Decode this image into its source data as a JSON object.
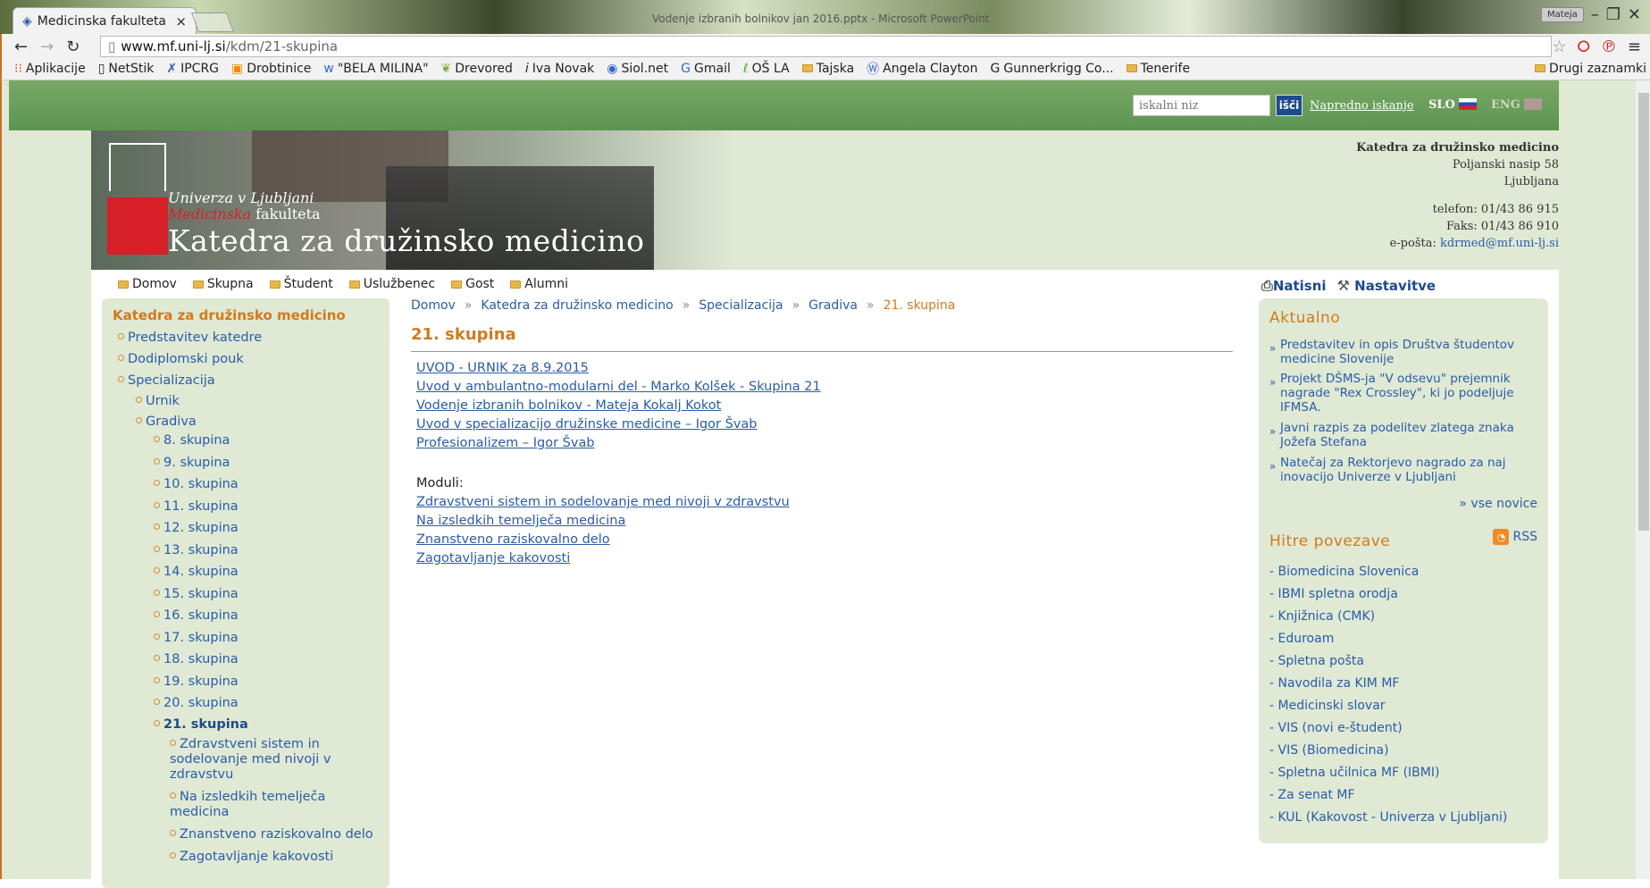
{
  "browser": {
    "tab_title": "Medicinska fakulteta",
    "tab_close": "×",
    "window_title_bg": "Vodenje izbranih bolnikov jan 2016.pptx - Microsoft PowerPoint",
    "user_badge": "Mateja",
    "url_host": "www.mf.uni-lj.si",
    "url_path": "/kdm/21-skupina",
    "bookmarks": [
      "Aplikacije",
      "NetStik",
      "IPCRG",
      "Drobtinice",
      "\"BELA MILINA\"",
      "Drevored",
      "Iva Novak",
      "Siol.net",
      "Gmail",
      "OŠ LA",
      "Tajska",
      "Angela Clayton",
      "Gunnerkrigg Co...",
      "Tenerife"
    ],
    "other_bookmarks": "Drugi zaznamki"
  },
  "topbar": {
    "search_placeholder": "iskalni niz",
    "search_button": "išči",
    "advanced_search": "Napredno iskanje",
    "lang_slo": "SLO",
    "lang_eng": "ENG"
  },
  "header": {
    "uni_line1": "Univerza v Ljubljani",
    "uni_line2_red": "Medicinska",
    "uni_line2": " fakulteta",
    "unit_name": "Katedra za družinsko medicino",
    "contact_name": "Katedra za družinsko medicino",
    "contact_street": "Poljanski nasip 58",
    "contact_city": "Ljubljana",
    "contact_phone": "telefon: 01/43 86 915",
    "contact_fax": "Faks: 01/43 86 910",
    "contact_email_label": "e-pošta: ",
    "contact_email": "kdrmed@mf.uni-lj.si"
  },
  "menu": [
    "Domov",
    "Skupna",
    "Študent",
    "Uslužbenec",
    "Gost",
    "Alumni"
  ],
  "tools": {
    "print": "Natisni",
    "settings": "Nastavitve"
  },
  "leftnav": {
    "title": "Katedra za družinsko medicino",
    "items": [
      "Predstavitev katedre",
      "Dodiplomski pouk",
      "Specializacija",
      "Urnik",
      "Gradiva",
      "8. skupina",
      "9. skupina",
      "10. skupina",
      "11. skupina",
      "12. skupina",
      "13. skupina",
      "14. skupina",
      "15. skupina",
      "16. skupina",
      "17. skupina",
      "18. skupina",
      "19. skupina",
      "20. skupina",
      "21. skupina",
      "Zdravstveni sistem in sodelovanje med nivoji v zdravstvu",
      "Na izsledkih temelječa medicina",
      "Znanstveno raziskovalno delo",
      "Zagotavljanje kakovosti"
    ]
  },
  "breadcrumb": [
    "Domov",
    "Katedra za družinsko medicino",
    "Specializacija",
    "Gradiva",
    "21. skupina"
  ],
  "breadcrumb_sep": "»",
  "main": {
    "title": "21. skupina",
    "links": [
      "UVOD - URNIK za 8.9.2015",
      "Uvod v ambulantno-modularni del - Marko Kolšek - Skupina 21",
      "Vodenje izbranih bolnikov - Mateja Kokalj Kokot",
      "Uvod v specializacijo družinske medicine – Igor Švab",
      "Profesionalizem – Igor Švab"
    ],
    "modules_label": "Moduli:",
    "modules": [
      "Zdravstveni sistem in sodelovanje med nivoji v zdravstvu",
      "Na izsledkih temelječa medicina",
      "Znanstveno raziskovalno delo",
      "Zagotavljanje kakovosti"
    ]
  },
  "aktualno": {
    "title": "Aktualno",
    "news": [
      "Predstavitev in opis Društva študentov medicine Slovenije",
      "Projekt DŠMS-ja \"V odsevu\" prejemnik nagrade \"Rex Crossley\", ki jo podeljuje IFMSA.",
      "Javni razpis za podelitev zlatega znaka Jožefa Stefana",
      "Natečaj za Rektorjevo nagrado za naj inovacijo Univerze v Ljubljani"
    ],
    "more": "» vse novice"
  },
  "quicklinks": {
    "title": "Hitre povezave",
    "rss": "RSS",
    "items": [
      "- Biomedicina Slovenica",
      "- IBMI spletna orodja",
      "- Knjižnica (CMK)",
      "- Eduroam",
      "- Spletna pošta",
      "- Navodila za KIM MF",
      "- Medicinski slovar",
      "- VIS (novi e-študent)",
      "- VIS (Biomedicina)",
      "- Spletna učilnica MF (IBMI)",
      "- Za senat MF",
      "- KUL (Kakovost - Univerza v Ljubljani)"
    ]
  },
  "colors": {
    "accent_orange": "#d07a1e",
    "link_blue": "#2a5ca8",
    "panel_green": "#dfe9d4",
    "top_green": "#6a9e5a"
  }
}
